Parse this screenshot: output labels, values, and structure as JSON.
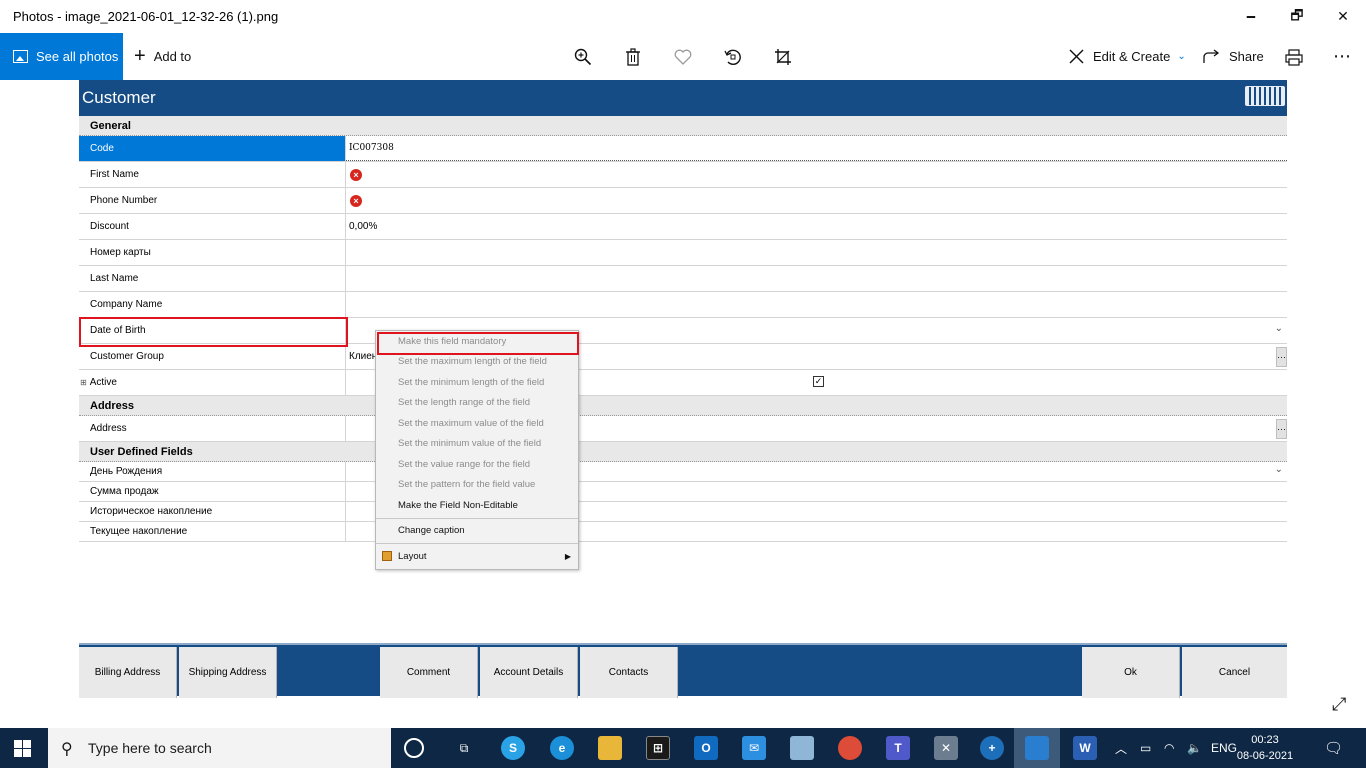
{
  "window": {
    "title": "Photos - image_2021-06-01_12-32-26 (1).png",
    "minimize": "🗕",
    "maximize": "🗗",
    "close": "✕"
  },
  "toolbar": {
    "see_all": "See all photos",
    "add_to": "Add to",
    "edit_create": "Edit & Create",
    "share": "Share",
    "more": "⋯"
  },
  "app": {
    "title": "Customer",
    "sections": {
      "general": "General",
      "address": "Address",
      "user_defined": "User Defined Fields"
    },
    "fields": {
      "code": {
        "label": "Code",
        "value": "IC007308"
      },
      "first_name": {
        "label": "First Name"
      },
      "phone_number": {
        "label": "Phone Number"
      },
      "discount": {
        "label": "Discount",
        "value": "0,00%"
      },
      "card_number": {
        "label": "Номер карты"
      },
      "last_name": {
        "label": "Last Name"
      },
      "company_name": {
        "label": "Company Name"
      },
      "date_of_birth": {
        "label": "Date of Birth"
      },
      "customer_group": {
        "label": "Customer Group",
        "value": "Клиен"
      },
      "active": {
        "label": "Active",
        "expander": "⊞"
      },
      "address": {
        "label": "Address"
      },
      "birthday": {
        "label": "День Рождения"
      },
      "sales_sum": {
        "label": "Сумма продаж"
      },
      "historic_accum": {
        "label": "Историческое накопление"
      },
      "current_accum": {
        "label": "Текущее накопление"
      }
    },
    "context_menu": {
      "items": [
        "Make this field mandatory",
        "Set the maximum length of the field",
        "Set the minimum length of the field",
        "Set the length range of the field",
        "Set the maximum value of the field",
        "Set the minimum value of the field",
        "Set the value range for the field",
        "Set the pattern for the field value",
        "Make the Field Non-Editable",
        "Change caption",
        "Layout"
      ]
    },
    "bottom_tabs": {
      "billing": "Billing Address",
      "shipping": "Shipping Address",
      "comment": "Comment",
      "account": "Account Details",
      "contacts": "Contacts",
      "ok": "Ok",
      "cancel": "Cancel"
    }
  },
  "taskbar": {
    "search_placeholder": "Type here to search",
    "lang": "ENG",
    "time": "00:23",
    "date": "08-06-2021",
    "accent": "#0078d7"
  }
}
